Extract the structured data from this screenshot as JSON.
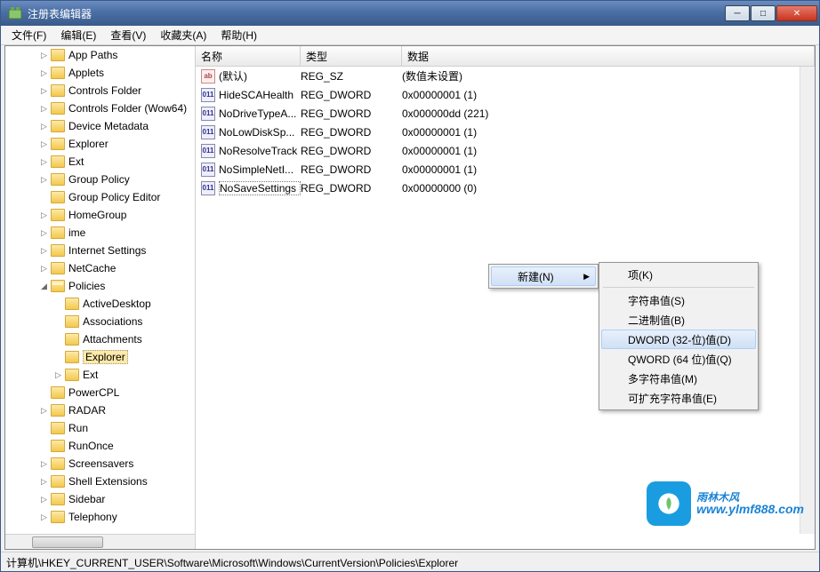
{
  "window": {
    "title": "注册表编辑器"
  },
  "menu": {
    "file": "文件(F)",
    "edit": "编辑(E)",
    "view": "查看(V)",
    "fav": "收藏夹(A)",
    "help": "帮助(H)"
  },
  "tree": {
    "items": [
      {
        "label": "App Paths",
        "depth": 2,
        "exp": "▷"
      },
      {
        "label": "Applets",
        "depth": 2,
        "exp": "▷"
      },
      {
        "label": "Controls Folder",
        "depth": 2,
        "exp": "▷"
      },
      {
        "label": "Controls Folder (Wow64)",
        "depth": 2,
        "exp": "▷"
      },
      {
        "label": "Device Metadata",
        "depth": 2,
        "exp": "▷"
      },
      {
        "label": "Explorer",
        "depth": 2,
        "exp": "▷"
      },
      {
        "label": "Ext",
        "depth": 2,
        "exp": "▷"
      },
      {
        "label": "Group Policy",
        "depth": 2,
        "exp": "▷"
      },
      {
        "label": "Group Policy Editor",
        "depth": 2,
        "exp": ""
      },
      {
        "label": "HomeGroup",
        "depth": 2,
        "exp": "▷"
      },
      {
        "label": "ime",
        "depth": 2,
        "exp": "▷"
      },
      {
        "label": "Internet Settings",
        "depth": 2,
        "exp": "▷"
      },
      {
        "label": "NetCache",
        "depth": 2,
        "exp": "▷"
      },
      {
        "label": "Policies",
        "depth": 2,
        "exp": "◢",
        "open": true
      },
      {
        "label": "ActiveDesktop",
        "depth": 3,
        "exp": ""
      },
      {
        "label": "Associations",
        "depth": 3,
        "exp": ""
      },
      {
        "label": "Attachments",
        "depth": 3,
        "exp": ""
      },
      {
        "label": "Explorer",
        "depth": 3,
        "exp": "",
        "selected": true
      },
      {
        "label": "Ext",
        "depth": 3,
        "exp": "▷"
      },
      {
        "label": "PowerCPL",
        "depth": 2,
        "exp": ""
      },
      {
        "label": "RADAR",
        "depth": 2,
        "exp": "▷"
      },
      {
        "label": "Run",
        "depth": 2,
        "exp": ""
      },
      {
        "label": "RunOnce",
        "depth": 2,
        "exp": ""
      },
      {
        "label": "Screensavers",
        "depth": 2,
        "exp": "▷"
      },
      {
        "label": "Shell Extensions",
        "depth": 2,
        "exp": "▷"
      },
      {
        "label": "Sidebar",
        "depth": 2,
        "exp": "▷"
      },
      {
        "label": "Telephony",
        "depth": 2,
        "exp": "▷"
      }
    ]
  },
  "list": {
    "headers": {
      "name": "名称",
      "type": "类型",
      "data": "数据"
    },
    "rows": [
      {
        "icon": "sz",
        "name": "(默认)",
        "type": "REG_SZ",
        "data": "(数值未设置)"
      },
      {
        "icon": "dw",
        "name": "HideSCAHealth",
        "type": "REG_DWORD",
        "data": "0x00000001 (1)"
      },
      {
        "icon": "dw",
        "name": "NoDriveTypeA...",
        "type": "REG_DWORD",
        "data": "0x000000dd (221)"
      },
      {
        "icon": "dw",
        "name": "NoLowDiskSp...",
        "type": "REG_DWORD",
        "data": "0x00000001 (1)"
      },
      {
        "icon": "dw",
        "name": "NoResolveTrack",
        "type": "REG_DWORD",
        "data": "0x00000001 (1)"
      },
      {
        "icon": "dw",
        "name": "NoSimpleNetI...",
        "type": "REG_DWORD",
        "data": "0x00000001 (1)"
      },
      {
        "icon": "dw",
        "name": "NoSaveSettings",
        "type": "REG_DWORD",
        "data": "0x00000000 (0)",
        "selected": true
      }
    ]
  },
  "ctx1": {
    "new": "新建(N)"
  },
  "ctx2": {
    "key": "项(K)",
    "string": "字符串值(S)",
    "binary": "二进制值(B)",
    "dword": "DWORD (32-位)值(D)",
    "qword": "QWORD (64 位)值(Q)",
    "multi": "多字符串值(M)",
    "expand": "可扩充字符串值(E)"
  },
  "status": "计算机\\HKEY_CURRENT_USER\\Software\\Microsoft\\Windows\\CurrentVersion\\Policies\\Explorer",
  "watermark": {
    "cn": "雨林木风",
    "url": "www.ylmf888.com"
  },
  "icons": {
    "ab": "ab",
    "dw": "011"
  }
}
